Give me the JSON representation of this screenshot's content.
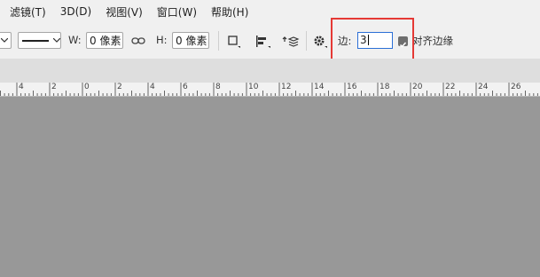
{
  "menu": [
    "滤镜(T)",
    "3D(D)",
    "视图(V)",
    "窗口(W)",
    "帮助(H)"
  ],
  "options": {
    "w_label": "W:",
    "w_value": "0 像素",
    "h_label": "H:",
    "h_value": "0 像素",
    "sides_label": "边:",
    "sides_value": "3",
    "align_edges_label": "对齐边缘",
    "align_edges_checked": true
  },
  "ruler": {
    "labels": [
      "4",
      "2",
      "0",
      "2",
      "4",
      "6",
      "8",
      "10",
      "12",
      "14",
      "16",
      "18",
      "20",
      "22",
      "24",
      "26"
    ]
  },
  "colors": {
    "highlight": "#e53935",
    "canvas": "#989898",
    "toolbar": "#f0f0f0"
  }
}
